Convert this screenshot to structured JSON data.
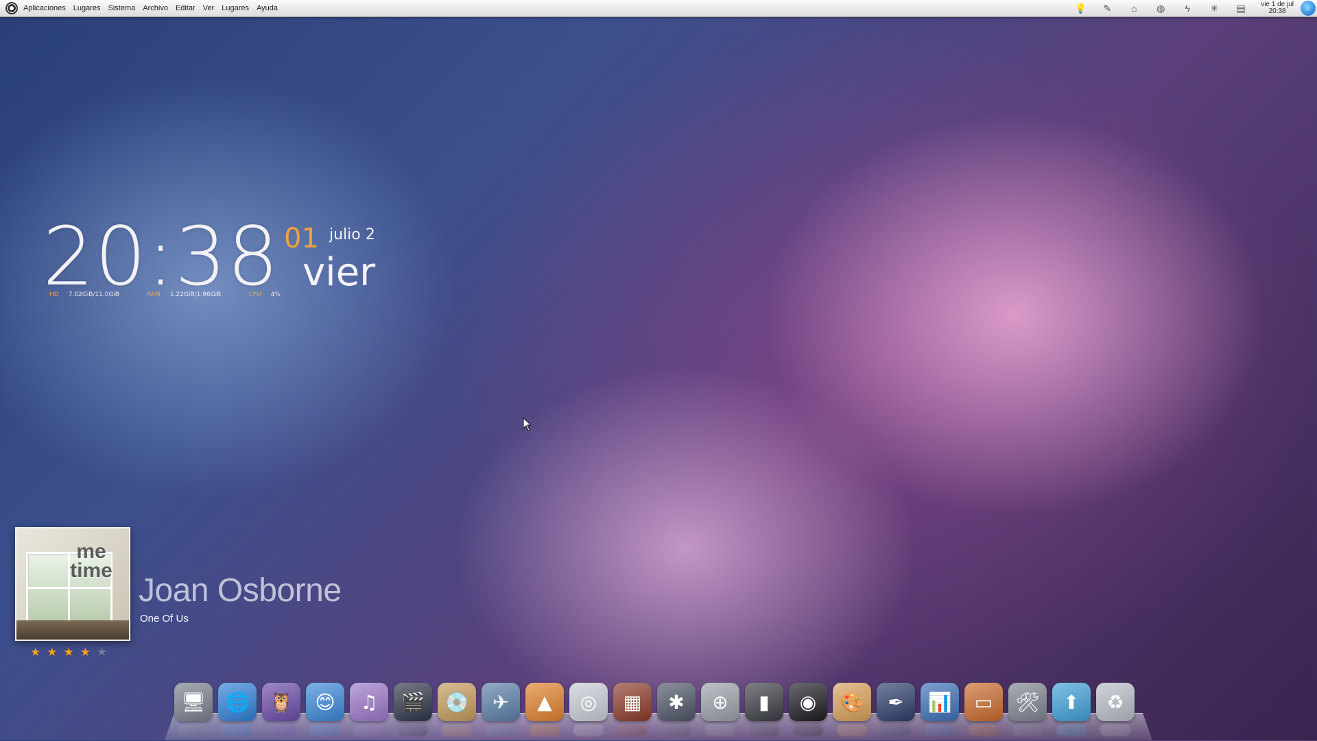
{
  "menubar": {
    "items": [
      "Aplicaciones",
      "Lugares",
      "Sistema",
      "Archivo",
      "Editar",
      "Ver",
      "Lugares",
      "Ayuda"
    ],
    "tray_icons": [
      "lightbulb-icon",
      "pen-icon",
      "basket-icon",
      "network-icon",
      "power-icon",
      "brightness-icon",
      "chat-icon"
    ],
    "clock_date": "vie 1 de jul",
    "clock_time": "20:38"
  },
  "clock_widget": {
    "time": "20:38",
    "day": "01",
    "month": "julio 2",
    "weekday": "vier",
    "stats": [
      {
        "label": "HD",
        "value": "7.02GiB/11.0GiB"
      },
      {
        "label": "RAM",
        "value": "1.22GiB/1.96GiB"
      },
      {
        "label": "CPU",
        "value": "4%"
      }
    ]
  },
  "music": {
    "album_title": "me time",
    "artist": "Joan Osborne",
    "song": "One Of Us",
    "rating": 4,
    "rating_max": 5
  },
  "dock": {
    "items": [
      {
        "name": "imac-icon",
        "glyph": "🖥",
        "color": "#7a7f8c"
      },
      {
        "name": "globe-network-icon",
        "glyph": "🌐",
        "color": "#2f7fd6"
      },
      {
        "name": "owl-chat-icon",
        "glyph": "🦉",
        "color": "#6a4aa8"
      },
      {
        "name": "messenger-icon",
        "glyph": "😊",
        "color": "#3a86d8"
      },
      {
        "name": "music-player-icon",
        "glyph": "♫",
        "color": "#9b76c8"
      },
      {
        "name": "video-editor-icon",
        "glyph": "🎬",
        "color": "#2d3548"
      },
      {
        "name": "disc-burner-icon",
        "glyph": "💿",
        "color": "#c49a5a"
      },
      {
        "name": "paper-plane-icon",
        "glyph": "✈",
        "color": "#5a7ea8"
      },
      {
        "name": "vlc-icon",
        "glyph": "▲",
        "color": "#e0802a"
      },
      {
        "name": "dvd-icon",
        "glyph": "◎",
        "color": "#c9ccd6"
      },
      {
        "name": "photo-booth-icon",
        "glyph": "▦",
        "color": "#8b3a2a"
      },
      {
        "name": "network-hub-icon",
        "glyph": "✱",
        "color": "#4d5566"
      },
      {
        "name": "disc-add-icon",
        "glyph": "⊕",
        "color": "#9aa0aa"
      },
      {
        "name": "ipod-icon",
        "glyph": "▮",
        "color": "#3a3d44"
      },
      {
        "name": "camera-icon",
        "glyph": "◉",
        "color": "#1c1c22"
      },
      {
        "name": "paint-icon",
        "glyph": "🎨",
        "color": "#d8a05a"
      },
      {
        "name": "ink-pen-icon",
        "glyph": "✒",
        "color": "#2b3d6a"
      },
      {
        "name": "chart-keynote-icon",
        "glyph": "📊",
        "color": "#3b6fb8"
      },
      {
        "name": "presentation-icon",
        "glyph": "▭",
        "color": "#c96a2a"
      },
      {
        "name": "tools-icon",
        "glyph": "🛠",
        "color": "#7d838f"
      },
      {
        "name": "app-store-icon",
        "glyph": "⬆",
        "color": "#3ea0d8"
      },
      {
        "name": "trash-icon",
        "glyph": "♻",
        "color": "#b8bcc6"
      }
    ]
  }
}
